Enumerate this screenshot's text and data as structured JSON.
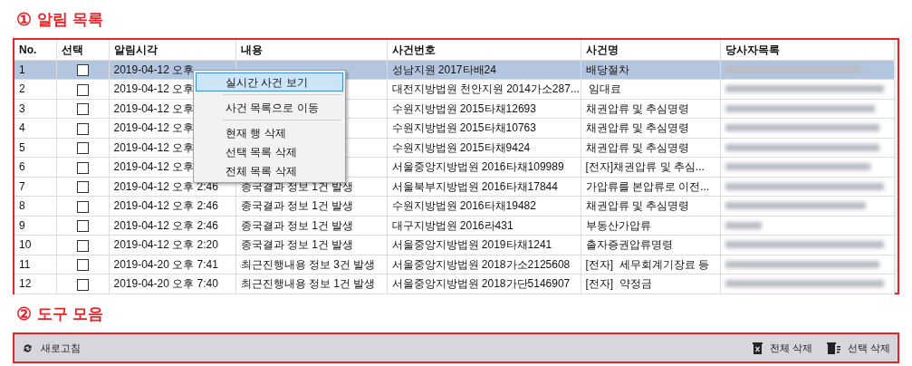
{
  "sections": [
    {
      "number": "①",
      "title": "알림 목록"
    },
    {
      "number": "②",
      "title": "도구 모음"
    }
  ],
  "table": {
    "columns": [
      "No.",
      "선택",
      "알림시각",
      "내용",
      "사건번호",
      "사건명",
      "당사자목록"
    ],
    "rows": [
      {
        "no": "1",
        "checked": false,
        "selected": true,
        "time": "2019-04-12 오후",
        "case_no": "성남지원 2017타배24",
        "case_name": "배당절차"
      },
      {
        "no": "2",
        "checked": false,
        "selected": false,
        "time": "2019-04-12 오후",
        "case_no": "대전지방법원 천안지원 2014가소287...",
        "case_name": " 임대료"
      },
      {
        "no": "3",
        "checked": false,
        "selected": false,
        "time": "2019-04-12 오후",
        "case_no": "수원지방법원 2015타채12693",
        "case_name": "채권압류 및 추심명령"
      },
      {
        "no": "4",
        "checked": false,
        "selected": false,
        "time": "2019-04-12 오후",
        "case_no": "수원지방법원 2015타채10763",
        "case_name": "채권압류 및 추심명령"
      },
      {
        "no": "5",
        "checked": false,
        "selected": false,
        "time": "2019-04-12 오후",
        "case_no": "수원지방법원 2015타채9424",
        "case_name": "채권압류 및 추심명령"
      },
      {
        "no": "6",
        "checked": false,
        "selected": false,
        "time": "2019-04-12 오후",
        "case_no": "서울중앙지방법원 2016타채109989",
        "case_name": "[전자]채권압류 및 추심..."
      },
      {
        "no": "7",
        "checked": false,
        "selected": false,
        "time": "2019-04-12 오후 2:46",
        "content": "종국결과 정보 1건 발생",
        "case_no": "서울북부지방법원 2016타채17844",
        "case_name": "가압류를 본압류로 이전..."
      },
      {
        "no": "8",
        "checked": false,
        "selected": false,
        "time": "2019-04-12 오후 2:46",
        "content": "종국결과 정보 1건 발생",
        "case_no": "수원지방법원 2016타채19482",
        "case_name": "채권압류 및 추심명령"
      },
      {
        "no": "9",
        "checked": false,
        "selected": false,
        "time": "2019-04-12 오후 2:46",
        "content": "종국결과 정보 1건 발생",
        "case_no": "대구지방법원 2016라431",
        "case_name": "부동산가압류"
      },
      {
        "no": "10",
        "checked": false,
        "selected": false,
        "time": "2019-04-12 오후 2:20",
        "content": "종국결과 정보 1건 발생",
        "case_no": "서울중앙지방법원 2019타채1241",
        "case_name": "출자증권압류명령"
      },
      {
        "no": "11",
        "checked": false,
        "selected": false,
        "time": "2019-04-20 오후 7:41",
        "content": "최근진행내용 정보 3건 발생",
        "case_no": "서울중앙지방법원 2018가소2125608",
        "case_name": "[전자]  세무회계기장료 등"
      },
      {
        "no": "12",
        "checked": false,
        "selected": false,
        "time": "2019-04-20 오후 7:40",
        "content": "최근진행내용 정보 1건 발생",
        "case_no": "서울중앙지방법원 2018가단5146907",
        "case_name": "[전자]  약정금"
      }
    ]
  },
  "context_menu": [
    {
      "label": "실시간 사건 보기",
      "selected": true
    },
    {
      "label": "사건 목록으로 이동",
      "selected": false
    },
    {
      "label": "현재 행 삭제",
      "selected": false
    },
    {
      "label": "선택 목록 삭제",
      "selected": false
    },
    {
      "label": "전체 목록 삭제",
      "selected": false
    }
  ],
  "toolbar": {
    "left": [
      {
        "kind": "refresh",
        "label": "새로고침"
      }
    ],
    "right": [
      {
        "kind": "delete-all",
        "label": "전체 삭제"
      },
      {
        "kind": "delete-selected",
        "label": "선택 삭제"
      }
    ]
  }
}
